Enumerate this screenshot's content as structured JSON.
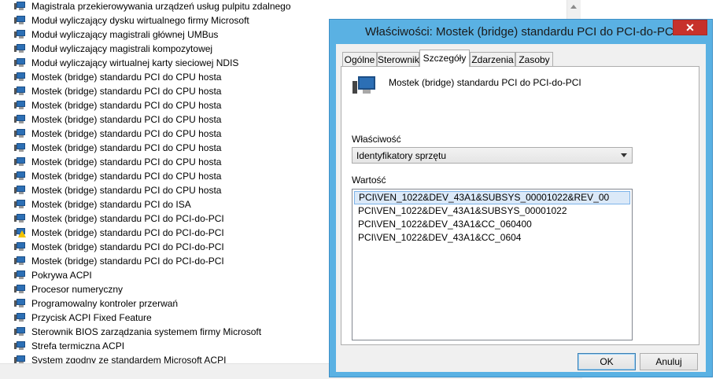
{
  "device_list": [
    {
      "label": "Magistrala przekierowywania urządzeń usług pulpitu zdalnego",
      "warning": false
    },
    {
      "label": "Moduł wyliczający dysku wirtualnego firmy Microsoft",
      "warning": false
    },
    {
      "label": "Moduł wyliczający magistrali głównej UMBus",
      "warning": false
    },
    {
      "label": "Moduł wyliczający magistrali kompozytowej",
      "warning": false
    },
    {
      "label": "Moduł wyliczający wirtualnej karty sieciowej NDIS",
      "warning": false
    },
    {
      "label": "Mostek (bridge) standardu PCI do CPU hosta",
      "warning": false
    },
    {
      "label": "Mostek (bridge) standardu PCI do CPU hosta",
      "warning": false
    },
    {
      "label": "Mostek (bridge) standardu PCI do CPU hosta",
      "warning": false
    },
    {
      "label": "Mostek (bridge) standardu PCI do CPU hosta",
      "warning": false
    },
    {
      "label": "Mostek (bridge) standardu PCI do CPU hosta",
      "warning": false
    },
    {
      "label": "Mostek (bridge) standardu PCI do CPU hosta",
      "warning": false
    },
    {
      "label": "Mostek (bridge) standardu PCI do CPU hosta",
      "warning": false
    },
    {
      "label": "Mostek (bridge) standardu PCI do CPU hosta",
      "warning": false
    },
    {
      "label": "Mostek (bridge) standardu PCI do CPU hosta",
      "warning": false
    },
    {
      "label": "Mostek (bridge) standardu PCI do ISA",
      "warning": false
    },
    {
      "label": "Mostek (bridge) standardu PCI do PCI-do-PCI",
      "warning": false
    },
    {
      "label": "Mostek (bridge) standardu PCI do PCI-do-PCI",
      "warning": true
    },
    {
      "label": "Mostek (bridge) standardu PCI do PCI-do-PCI",
      "warning": false
    },
    {
      "label": "Mostek (bridge) standardu PCI do PCI-do-PCI",
      "warning": false
    },
    {
      "label": "Pokrywa ACPI",
      "warning": false
    },
    {
      "label": "Procesor numeryczny",
      "warning": false
    },
    {
      "label": "Programowalny kontroler przerwań",
      "warning": false
    },
    {
      "label": "Przycisk ACPI Fixed Feature",
      "warning": false
    },
    {
      "label": "Sterownik BIOS zarządzania systemem firmy Microsoft",
      "warning": false
    },
    {
      "label": "Strefa termiczna ACPI",
      "warning": false
    },
    {
      "label": "System zgodny ze standardem Microsoft ACPI",
      "warning": false
    }
  ],
  "dialog": {
    "title": "Właściwości: Mostek (bridge) standardu PCI do PCI-do-PCI",
    "close_label": "✕",
    "tabs": [
      {
        "label": "Ogólne",
        "active": false
      },
      {
        "label": "Sterownik",
        "active": false
      },
      {
        "label": "Szczegóły",
        "active": true
      },
      {
        "label": "Zdarzenia",
        "active": false
      },
      {
        "label": "Zasoby",
        "active": false
      }
    ],
    "device_name": "Mostek (bridge) standardu PCI do PCI-do-PCI",
    "property_label": "Właściwość",
    "property_value": "Identyfikatory sprzętu",
    "value_label": "Wartość",
    "values": [
      "PCI\\VEN_1022&DEV_43A1&SUBSYS_00001022&REV_00",
      "PCI\\VEN_1022&DEV_43A1&SUBSYS_00001022",
      "PCI\\VEN_1022&DEV_43A1&CC_060400",
      "PCI\\VEN_1022&DEV_43A1&CC_0604"
    ],
    "selected_value_index": 0,
    "ok_label": "OK",
    "cancel_label": "Anuluj"
  },
  "colors": {
    "window_frame": "#5ab1e3",
    "close_button": "#c7312b",
    "selection": "#dbe9f8"
  }
}
